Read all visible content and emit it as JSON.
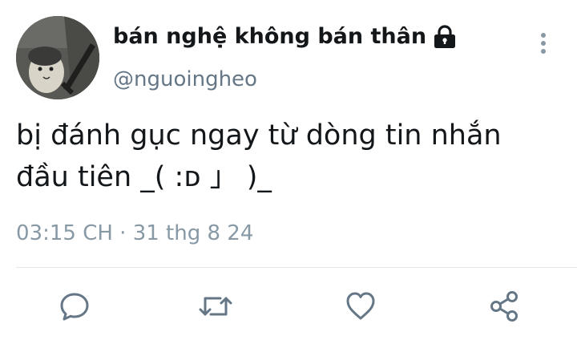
{
  "tweet": {
    "author": {
      "display_name": "bán nghệ không bán thân",
      "handle": "@nguoingheo",
      "avatar_icon": "avatar-photo",
      "protected_icon": "lock-icon"
    },
    "text_lines": [
      "bị đánh gục ngay từ dòng tin nhắn",
      "đầu tiên _( :ᴅ 」 )_"
    ],
    "timestamp": "03:15 CH · 31 thg 8 24"
  },
  "actions": [
    {
      "name": "reply",
      "icon": "speech-bubble-icon"
    },
    {
      "name": "retweet",
      "icon": "retweet-icon"
    },
    {
      "name": "like",
      "icon": "heart-icon"
    },
    {
      "name": "share",
      "icon": "share-icon"
    }
  ],
  "colors": {
    "text_primary": "#14171a",
    "text_secondary": "#657786",
    "icon_gray": "#657786",
    "divider": "#e1e8ed",
    "background": "#ffffff"
  }
}
